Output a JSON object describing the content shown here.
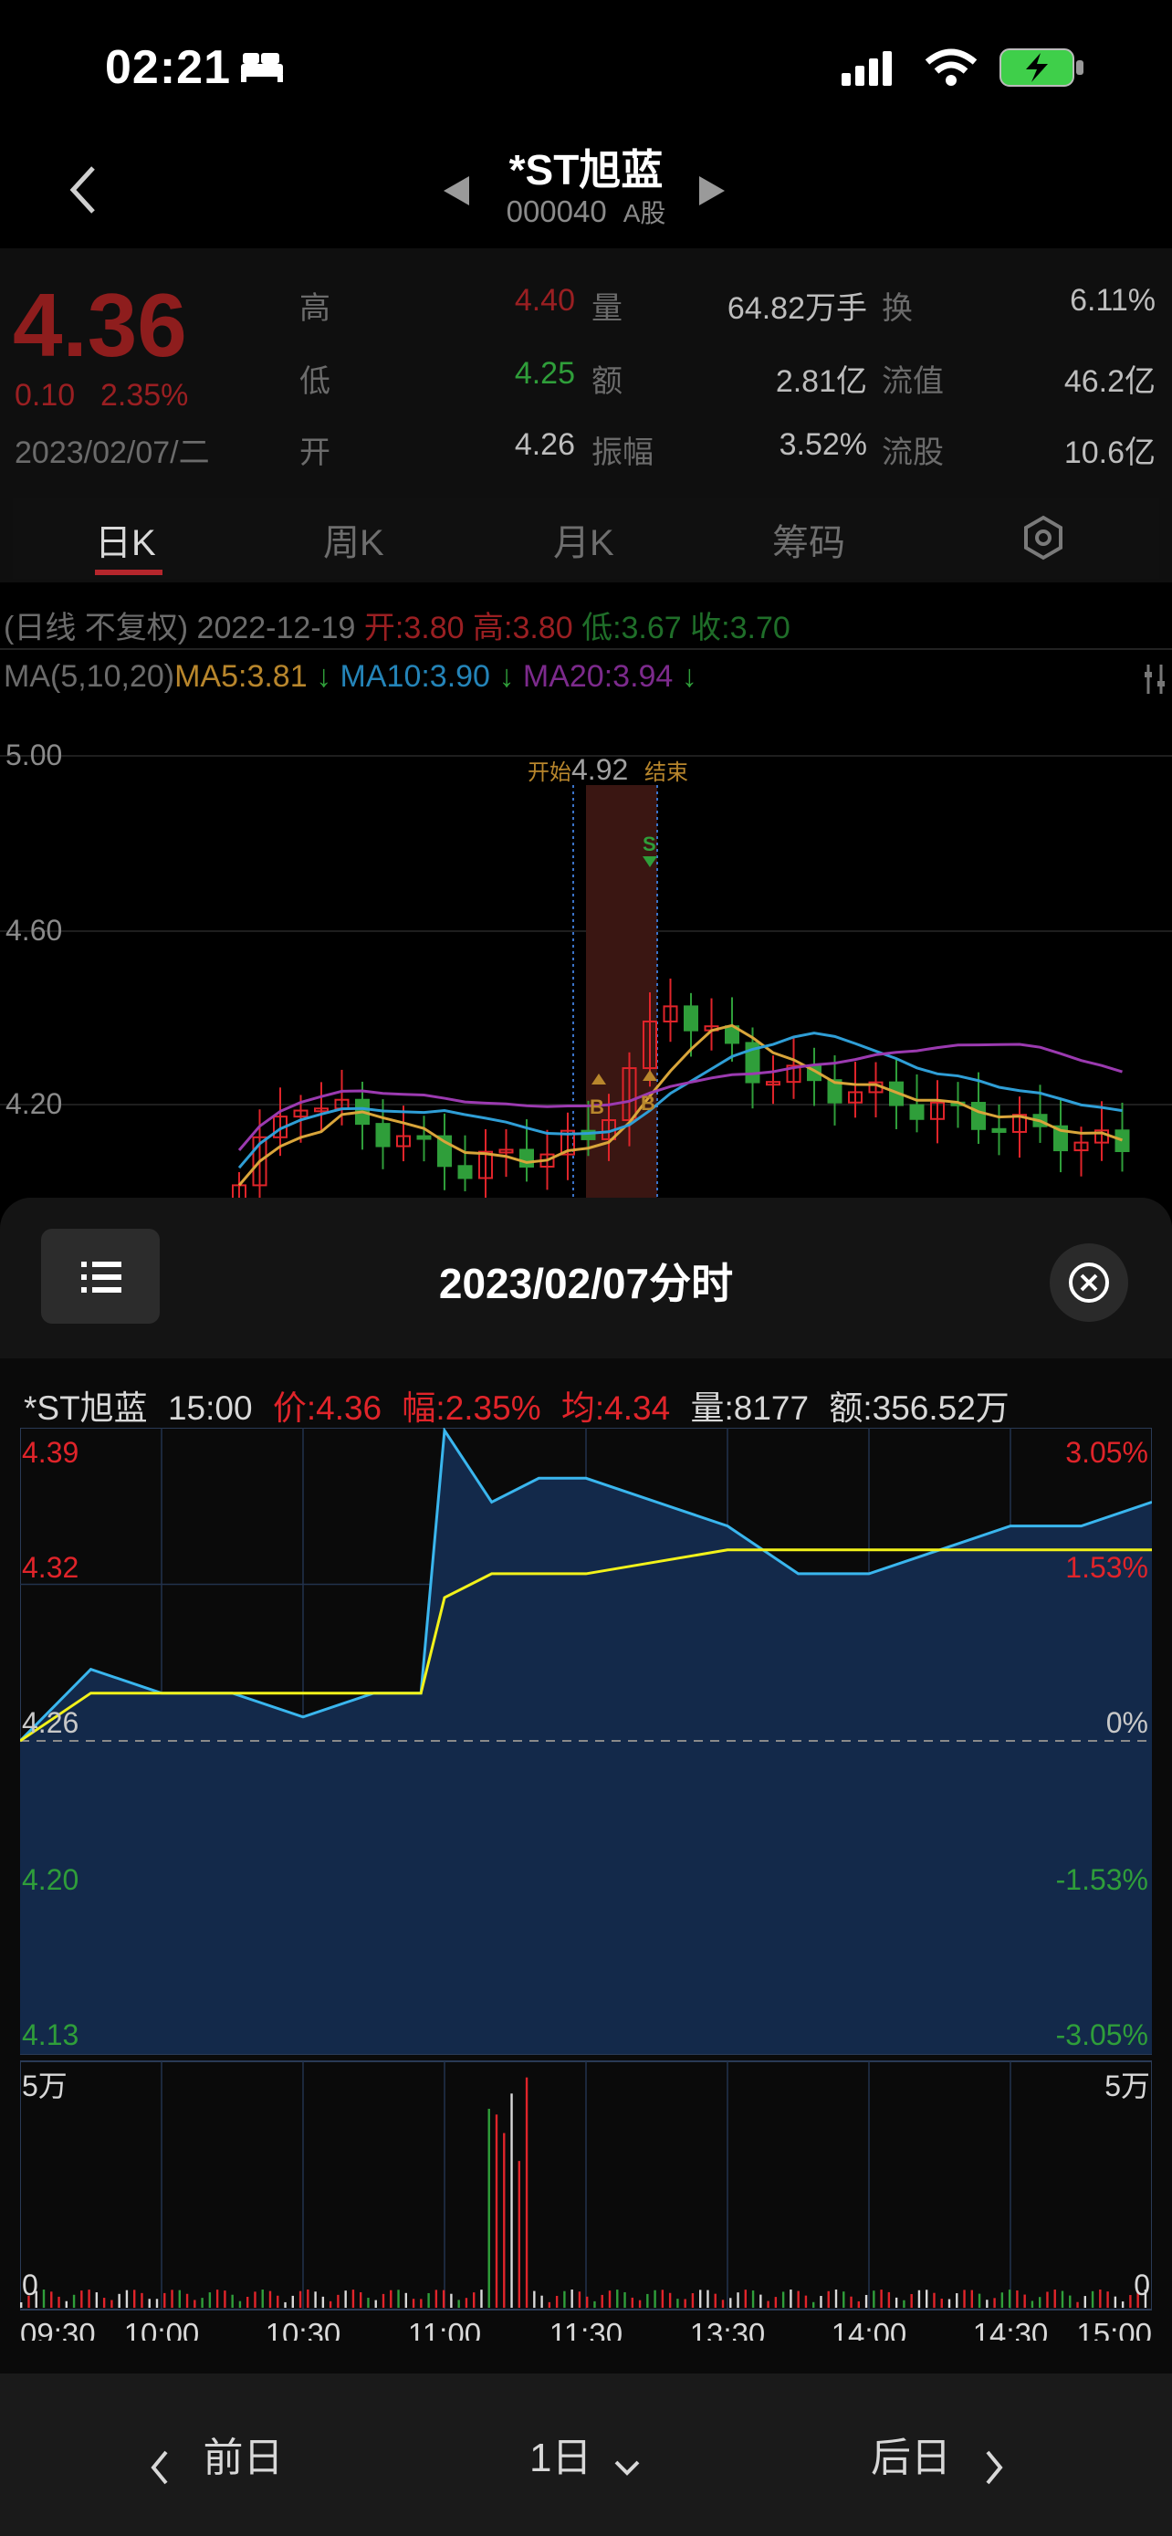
{
  "status": {
    "time": "02:21"
  },
  "header": {
    "name": "*ST旭蓝",
    "code": "000040",
    "market": "A股"
  },
  "quote": {
    "price": "4.36",
    "change": "0.10",
    "change_pct": "2.35%",
    "date": "2023/02/07/二",
    "rows": [
      {
        "l1": "高",
        "v1": "4.40",
        "l2": "量",
        "v2": "64.82万手",
        "l3": "换",
        "v3": "6.11%"
      },
      {
        "l1": "低",
        "v1": "4.25",
        "l2": "额",
        "v2": "2.81亿",
        "l3": "流值",
        "v3": "46.2亿"
      },
      {
        "l1": "开",
        "v1": "4.26",
        "l2": "振幅",
        "v2": "3.52%",
        "l3": "流股",
        "v3": "10.6亿"
      }
    ]
  },
  "tabs": [
    "日K",
    "周K",
    "月K",
    "筹码"
  ],
  "kline": {
    "info_prefix": "(日线 不复权)",
    "date": "2022-12-19",
    "open": "开:3.80",
    "high": "高:3.80",
    "low": "低:3.67",
    "close": "收:3.70",
    "ma_label": "MA(5,10,20)",
    "ma5": "MA5:3.81",
    "ma10": "MA10:3.90",
    "ma20": "MA20:3.94",
    "arrow": "↓",
    "y_labels": [
      "5.00",
      "4.60",
      "4.20"
    ],
    "range_start": "开始",
    "range_value": "4.92",
    "range_end": "结束",
    "mark_b": "B",
    "mark_s": "S",
    "colors": {
      "ma5": "#d9a53a",
      "ma10": "#2f9ed6",
      "ma20": "#9b3ab0",
      "up": "#e0242a",
      "down": "#2f9e3a"
    }
  },
  "sheet": {
    "title": "2023/02/07分时",
    "info": {
      "name": "*ST旭蓝",
      "time": "15:00",
      "price": "价:4.36",
      "pct": "幅:2.35%",
      "avg": "均:4.34",
      "vol": "量:8177",
      "amt": "额:356.52万"
    }
  },
  "chart_data": {
    "type": "line",
    "title": "",
    "x_ticks": [
      "09:30",
      "10:00",
      "10:30",
      "11:00",
      "11:30",
      "13:30",
      "14:00",
      "14:30",
      "15:00"
    ],
    "y_left": [
      "4.39",
      "4.32",
      "4.26",
      "4.20",
      "4.13"
    ],
    "y_right": [
      "3.05%",
      "1.53%",
      "0%",
      "-1.53%",
      "-3.05%"
    ],
    "ylim": [
      4.13,
      4.39
    ],
    "prev_close": 4.26,
    "series": [
      {
        "name": "价",
        "x": [
          "09:30",
          "09:45",
          "10:00",
          "10:15",
          "10:30",
          "10:45",
          "10:55",
          "11:00",
          "11:10",
          "11:20",
          "11:30",
          "13:30",
          "13:45",
          "14:00",
          "14:15",
          "14:30",
          "14:45",
          "15:00"
        ],
        "values": [
          4.26,
          4.29,
          4.28,
          4.28,
          4.27,
          4.28,
          4.28,
          4.39,
          4.36,
          4.37,
          4.37,
          4.35,
          4.33,
          4.33,
          4.34,
          4.35,
          4.35,
          4.36
        ]
      },
      {
        "name": "均",
        "x": [
          "09:30",
          "09:45",
          "10:00",
          "10:15",
          "10:30",
          "10:45",
          "10:55",
          "11:00",
          "11:10",
          "11:20",
          "11:30",
          "13:30",
          "13:45",
          "14:00",
          "14:15",
          "14:30",
          "14:45",
          "15:00"
        ],
        "values": [
          4.26,
          4.28,
          4.28,
          4.28,
          4.28,
          4.28,
          4.28,
          4.32,
          4.33,
          4.33,
          4.33,
          4.34,
          4.34,
          4.34,
          4.34,
          4.34,
          4.34,
          4.34
        ]
      }
    ],
    "volume_label_max": "5万",
    "volume_label_min": "0"
  },
  "footer": {
    "prev": "前日",
    "period": "1日",
    "next": "后日"
  }
}
